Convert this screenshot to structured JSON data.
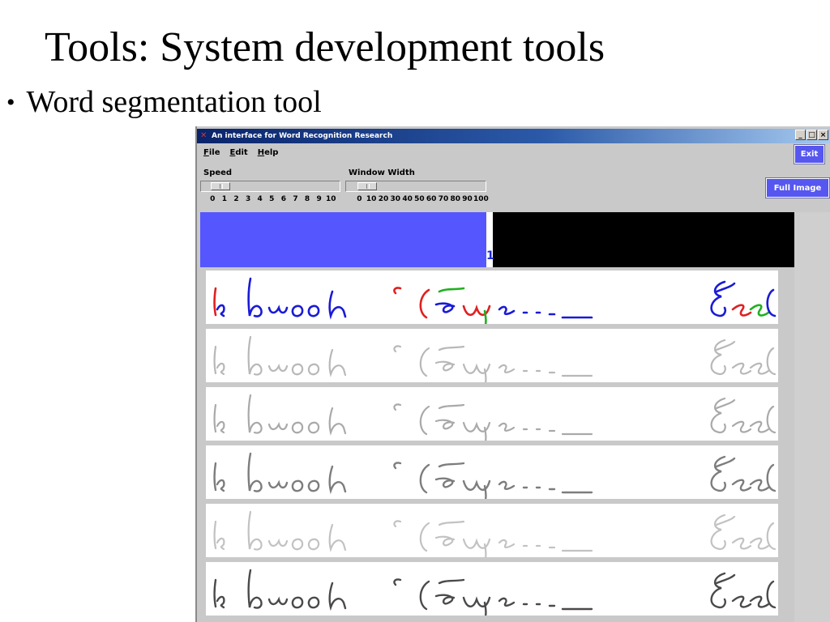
{
  "slide": {
    "title": "Tools: System development tools",
    "bullet": "Word segmentation tool"
  },
  "window": {
    "title": "An interface for Word Recognition Research",
    "controls": [
      "_",
      "□",
      "×"
    ],
    "menu": [
      "File",
      "Edit",
      "Help"
    ],
    "exit_label": "Exit",
    "full_image_label": "Full Image"
  },
  "speed": {
    "label": "Speed",
    "ticks": [
      "0",
      "1",
      "2",
      "3",
      "4",
      "5",
      "6",
      "7",
      "8",
      "9",
      "10"
    ],
    "value": 1
  },
  "window_width": {
    "label": "Window  Width",
    "ticks": [
      "0",
      "10",
      "20",
      "30",
      "40",
      "50",
      "60",
      "70",
      "80",
      "90",
      "100"
    ],
    "value": 10
  },
  "preview": {
    "marker": "1",
    "left_color": "#5656ff",
    "right_color": "#000000"
  },
  "strips": [
    {
      "name": "colored-segmentation",
      "style": "color"
    },
    {
      "name": "gray-light-1",
      "style": "gray1"
    },
    {
      "name": "gray-light-2",
      "style": "gray2"
    },
    {
      "name": "gray-medium",
      "style": "gray3"
    },
    {
      "name": "gray-light-3",
      "style": "gray4"
    },
    {
      "name": "gray-dark",
      "style": "gray5"
    }
  ],
  "colors": {
    "button_blue": "#5656f0",
    "titlebar_start": "#0a246a",
    "titlebar_end": "#a6caf0"
  }
}
